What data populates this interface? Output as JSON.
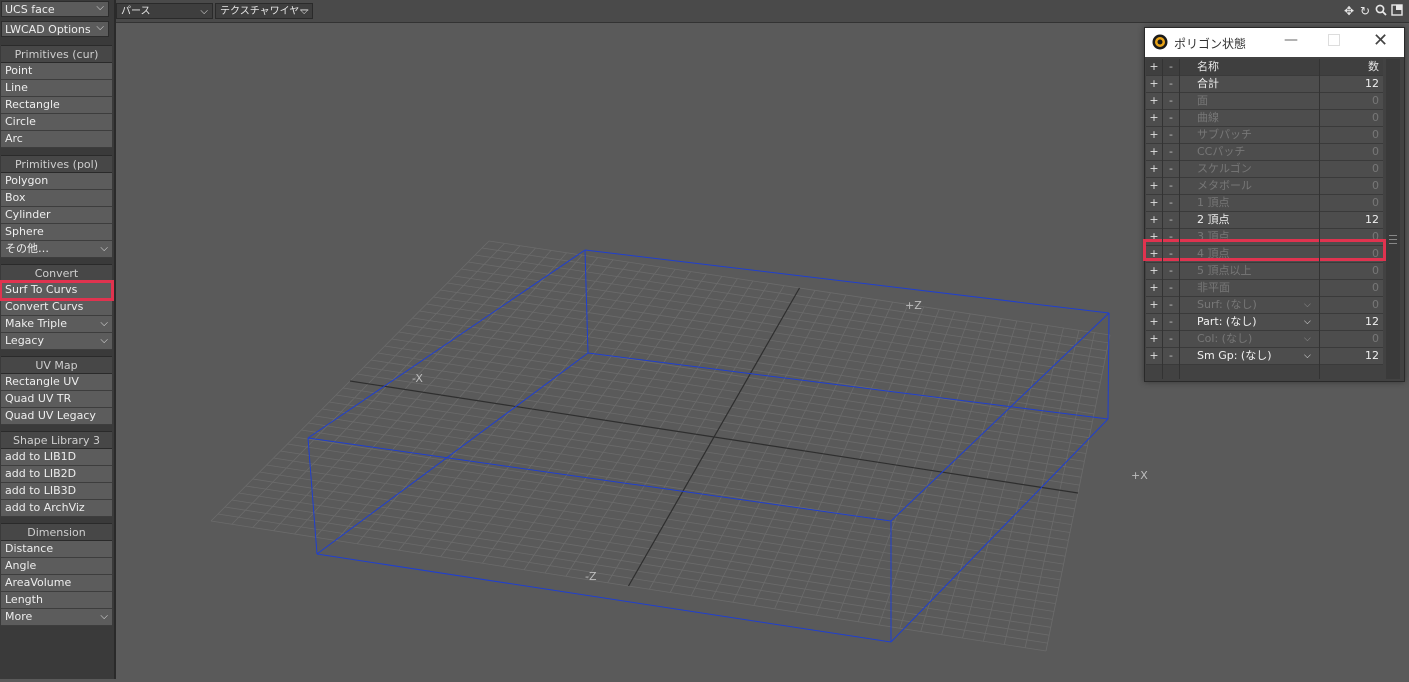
{
  "sidebar": {
    "ucs": "UCS face",
    "lwcad": "LWCAD Options",
    "groups": [
      {
        "title": "Primitives (cur)",
        "items": [
          "Point",
          "Line",
          "Rectangle",
          "Circle",
          "Arc"
        ]
      },
      {
        "title": "Primitives (pol)",
        "items": [
          "Polygon",
          "Box",
          "Cylinder",
          "Sphere",
          "その他…"
        ]
      },
      {
        "title": "Convert",
        "items": [
          "Surf To Curvs",
          "Convert Curvs",
          "Make Triple",
          "Legacy"
        ]
      },
      {
        "title": "UV Map",
        "items": [
          "Rectangle UV",
          "Quad UV TR",
          "Quad UV Legacy"
        ]
      },
      {
        "title": "Shape Library 3",
        "items": [
          "add to LIB1D",
          "add to LIB2D",
          "add to LIB3D",
          "add to ArchViz"
        ]
      },
      {
        "title": "Dimension",
        "items": [
          "Distance",
          "Angle",
          "AreaVolume",
          "Length",
          "More"
        ]
      }
    ]
  },
  "viewport": {
    "view_mode": "パース",
    "render_mode": "テクスチャワイヤー",
    "axis_labels": {
      "pz": "+Z",
      "mz": "-Z",
      "px": "+X",
      "mx": "-X"
    }
  },
  "polygon_window": {
    "title": "ポリゴン状態",
    "header": {
      "plus": "+",
      "minus": "-",
      "name": "名称",
      "count": "数"
    },
    "rows": [
      {
        "name": "合計",
        "count": "12",
        "on": true
      },
      {
        "name": "面",
        "count": "0",
        "on": false
      },
      {
        "name": "曲線",
        "count": "0",
        "on": false
      },
      {
        "name": "サブパッチ",
        "count": "0",
        "on": false
      },
      {
        "name": "CCパッチ",
        "count": "0",
        "on": false
      },
      {
        "name": "スケルゴン",
        "count": "0",
        "on": false
      },
      {
        "name": "メタボール",
        "count": "0",
        "on": false
      },
      {
        "name": "1 頂点",
        "count": "0",
        "on": false
      },
      {
        "name": "2 頂点",
        "count": "12",
        "on": true
      },
      {
        "name": "3 頂点",
        "count": "0",
        "on": false
      },
      {
        "name": "4 頂点",
        "count": "0",
        "on": false
      },
      {
        "name": "5 頂点以上",
        "count": "0",
        "on": false
      },
      {
        "name": "非平面",
        "count": "0",
        "on": false
      },
      {
        "name": "Surf: (なし)",
        "count": "0",
        "on": false
      },
      {
        "name": "Part: (なし)",
        "count": "12",
        "on": true
      },
      {
        "name": "Col: (なし)",
        "count": "0",
        "on": false
      },
      {
        "name": "Sm Gp: (なし)",
        "count": "12",
        "on": true
      }
    ]
  },
  "colors": {
    "accent_highlight": "#e0334f",
    "wire_blue": "#1f3fd0",
    "grid": "#6b6b6b"
  }
}
